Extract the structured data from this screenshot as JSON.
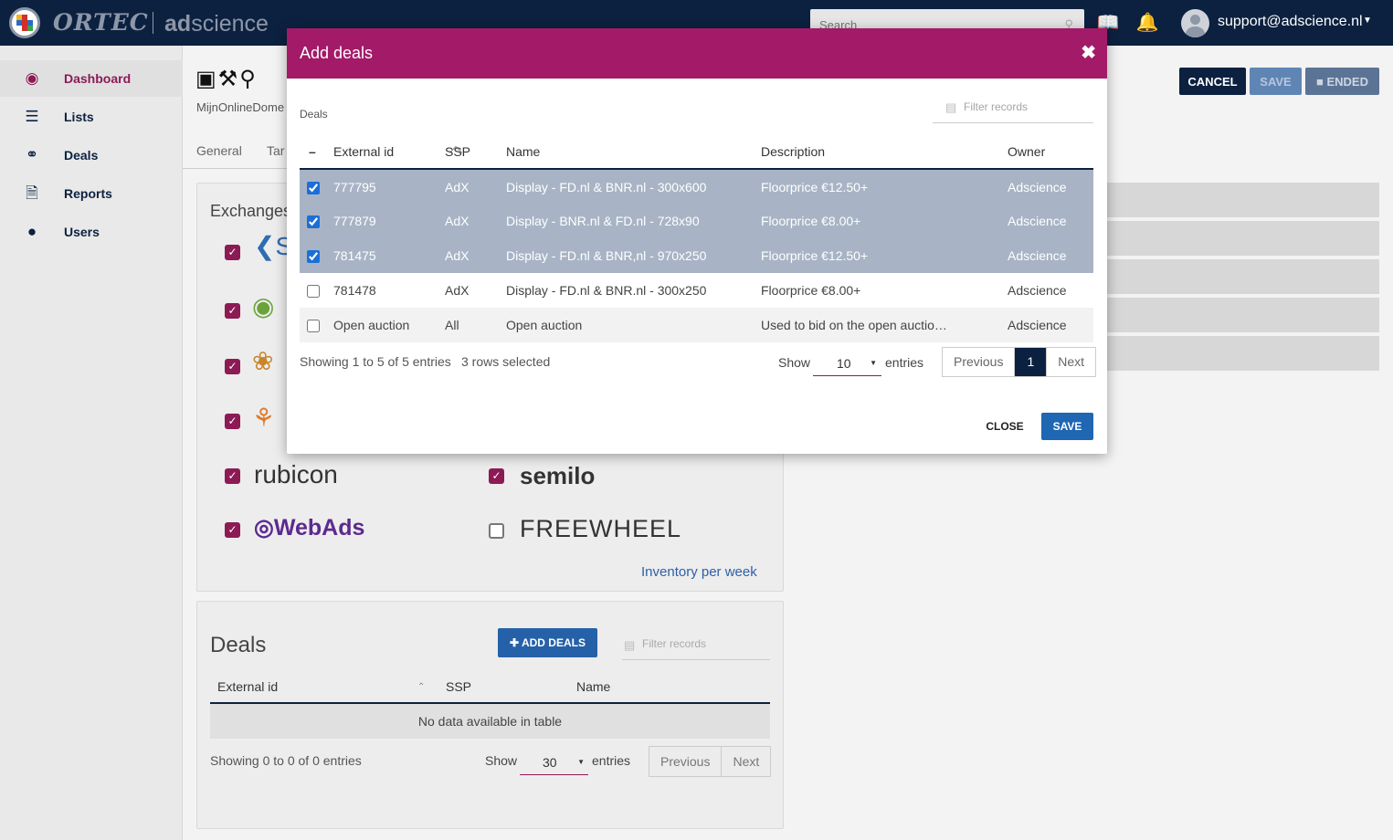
{
  "header": {
    "brand_left": "ORTEC",
    "brand_right_bold": "ad",
    "brand_right": "science",
    "search_placeholder": "Search",
    "user_email": "support@adscience.nl"
  },
  "sidebar": {
    "items": [
      {
        "label": "Dashboard",
        "icon": "dashboard-icon"
      },
      {
        "label": "Lists",
        "icon": "list-icon"
      },
      {
        "label": "Deals",
        "icon": "handshake-icon"
      },
      {
        "label": "Reports",
        "icon": "report-icon"
      },
      {
        "label": "Users",
        "icon": "user-icon"
      }
    ]
  },
  "page": {
    "subtitle": "MijnOnlineDome",
    "tabs": [
      "General",
      "Tar"
    ],
    "actions": {
      "cancel": "CANCEL",
      "save": "SAVE",
      "ended": "ENDED"
    },
    "exchanges_title": "Exchanges",
    "inventory_link": "Inventory per week",
    "deals_title": "Deals",
    "add_deals": "ADD DEALS",
    "filter_placeholder": "Filter records",
    "deals_table": {
      "columns": [
        "External id",
        "SSP",
        "Name"
      ],
      "empty": "No data available in table",
      "showing": "Showing 0 to 0 of 0 entries",
      "show": "Show",
      "page_size": "30",
      "entries": "entries",
      "previous": "Previous",
      "next": "Next"
    }
  },
  "modal": {
    "title": "Add deals",
    "deals_label": "Deals",
    "filter_placeholder": "Filter records",
    "columns": [
      "External id",
      "SSP",
      "Name",
      "Description",
      "Owner"
    ],
    "rows": [
      {
        "id": "777795",
        "ssp": "AdX",
        "name": "Display - FD.nl & BNR.nl - 300x600",
        "description": "Floorprice €12.50+",
        "owner": "Adscience",
        "checked": true
      },
      {
        "id": "777879",
        "ssp": "AdX",
        "name": "Display - BNR.nl & FD.nl - 728x90",
        "description": "Floorprice €8.00+",
        "owner": "Adscience",
        "checked": true
      },
      {
        "id": "781475",
        "ssp": "AdX",
        "name": "Display - FD.nl & BNR,nl - 970x250",
        "description": "Floorprice €12.50+",
        "owner": "Adscience",
        "checked": true
      },
      {
        "id": "781478",
        "ssp": "AdX",
        "name": "Display - FD.nl & BNR.nl - 300x250",
        "description": "Floorprice €8.00+",
        "owner": "Adscience",
        "checked": false
      },
      {
        "id": "Open auction",
        "ssp": "All",
        "name": "Open auction",
        "description": "Used to bid on the open auctio…",
        "owner": "Adscience",
        "checked": false
      }
    ],
    "showing": "Showing 1 to 5 of 5 entries",
    "rows_selected": "3 rows selected",
    "show": "Show",
    "page_size": "10",
    "entries": "entries",
    "previous": "Previous",
    "current_page": "1",
    "next": "Next",
    "close": "CLOSE",
    "save": "SAVE"
  },
  "colors": {
    "topbar": "#0c2140",
    "modal_header": "#a31a68",
    "accent": "#8c1a55",
    "primary_button": "#1f66b3",
    "selected_row": "#a8b4c5"
  }
}
